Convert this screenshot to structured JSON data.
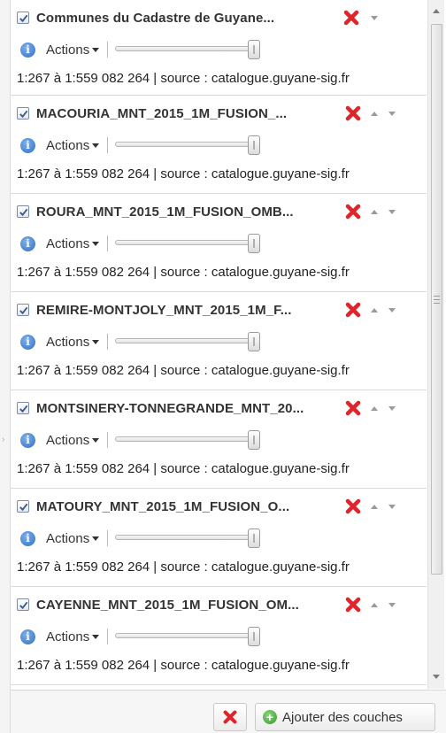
{
  "layers": [
    {
      "title": "Communes du Cadastre de Guyane...",
      "actions_label": "Actions",
      "scale_source": "1:267 à 1:559 082 264 | source : catalogue.guyane-sig.fr",
      "checked": true,
      "show_up": false,
      "opacity": 1
    },
    {
      "title": "MACOURIA_MNT_2015_1M_FUSION_...",
      "actions_label": "Actions",
      "scale_source": "1:267 à 1:559 082 264 | source : catalogue.guyane-sig.fr",
      "checked": true,
      "show_up": true,
      "opacity": 1
    },
    {
      "title": "ROURA_MNT_2015_1M_FUSION_OMB...",
      "actions_label": "Actions",
      "scale_source": "1:267 à 1:559 082 264 | source : catalogue.guyane-sig.fr",
      "checked": true,
      "show_up": true,
      "opacity": 1
    },
    {
      "title": "REMIRE-MONTJOLY_MNT_2015_1M_F...",
      "actions_label": "Actions",
      "scale_source": "1:267 à 1:559 082 264 | source : catalogue.guyane-sig.fr",
      "checked": true,
      "show_up": true,
      "opacity": 1
    },
    {
      "title": "MONTSINERY-TONNEGRANDE_MNT_20...",
      "actions_label": "Actions",
      "scale_source": "1:267 à 1:559 082 264 | source : catalogue.guyane-sig.fr",
      "checked": true,
      "show_up": true,
      "opacity": 1
    },
    {
      "title": "MATOURY_MNT_2015_1M_FUSION_O...",
      "actions_label": "Actions",
      "scale_source": "1:267 à 1:559 082 264 | source : catalogue.guyane-sig.fr",
      "checked": true,
      "show_up": true,
      "opacity": 1
    },
    {
      "title": "CAYENNE_MNT_2015_1M_FUSION_OM...",
      "actions_label": "Actions",
      "scale_source": "1:267 à 1:559 082 264 | source : catalogue.guyane-sig.fr",
      "checked": true,
      "show_up": true,
      "opacity": 1
    }
  ],
  "icons": {
    "checkbox": "checkmark-icon",
    "info": "info-icon",
    "delete": "red-x-icon",
    "move_up": "triangle-up-icon",
    "move_down": "triangle-down-icon",
    "add": "green-plus-icon"
  },
  "footer": {
    "add_label": "Ajouter des couches"
  },
  "colors": {
    "delete_red": "#e0242c",
    "info_blue": "#2f6fc6",
    "add_green": "#3a9a2e"
  }
}
